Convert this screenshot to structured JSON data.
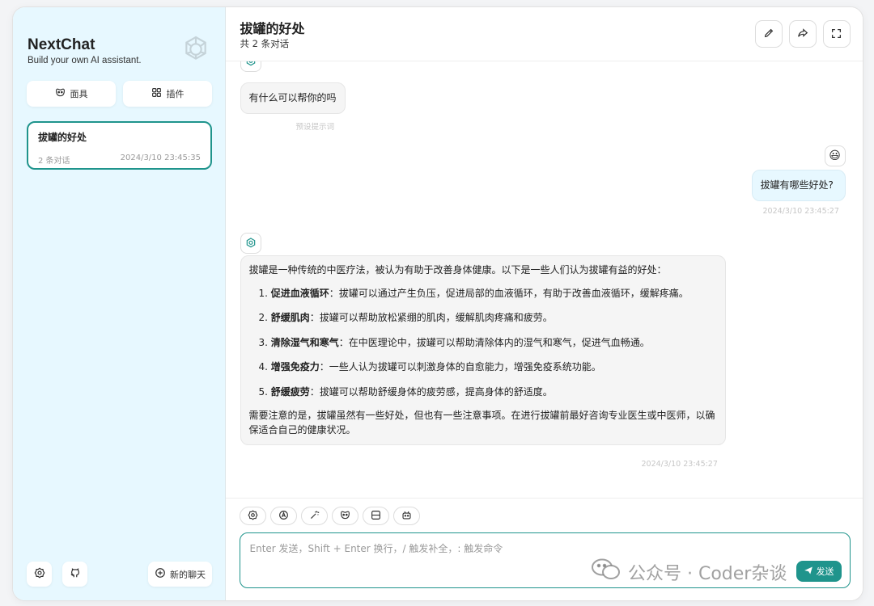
{
  "sidebar": {
    "brand_title": "NextChat",
    "brand_subtitle": "Build your own AI assistant.",
    "mask_label": "面具",
    "plugin_label": "插件",
    "chat_item": {
      "title": "拔罐的好处",
      "count": "2 条对话",
      "time": "2024/3/10 23:45:35"
    },
    "new_chat_label": "新的聊天"
  },
  "header": {
    "title": "拔罐的好处",
    "subtitle": "共 2 条对话"
  },
  "messages": {
    "greeting": "有什么可以帮你的吗",
    "greeting_note": "预设提示词",
    "user_question": "拔罐有哪些好处?",
    "user_time": "2024/3/10 23:45:27",
    "reply_intro": "拔罐是一种传统的中医疗法，被认为有助于改善身体健康。以下是一些人们认为拔罐有益的好处：",
    "reply_items": [
      {
        "num": "1.",
        "title": "促进血液循环",
        "text": "：拔罐可以通过产生负压，促进局部的血液循环，有助于改善血液循环，缓解疼痛。"
      },
      {
        "num": "2.",
        "title": "舒缓肌肉",
        "text": "：拔罐可以帮助放松紧绷的肌肉，缓解肌肉疼痛和疲劳。"
      },
      {
        "num": "3.",
        "title": "清除湿气和寒气",
        "text": "：在中医理论中，拔罐可以帮助清除体内的湿气和寒气，促进气血畅通。"
      },
      {
        "num": "4.",
        "title": "增强免疫力",
        "text": "：一些人认为拔罐可以刺激身体的自愈能力，增强免疫系统功能。"
      },
      {
        "num": "5.",
        "title": "舒缓疲劳",
        "text": "：拔罐可以帮助舒缓身体的疲劳感，提高身体的舒适度。"
      }
    ],
    "reply_outro": "需要注意的是，拔罐虽然有一些好处，但也有一些注意事项。在进行拔罐前最好咨询专业医生或中医师，以确保适合自己的健康状况。",
    "reply_time": "2024/3/10 23:45:27",
    "user_avatar": "😃"
  },
  "composer": {
    "placeholder": "Enter 发送，Shift + Enter 换行，/ 触发补全，: 触发命令",
    "send_label": "发送"
  },
  "watermark": "公众号 · Coder杂谈",
  "colors": {
    "accent": "#1f948c",
    "sidebar_bg": "#e7f8ff",
    "user_bubble": "#e7f8ff",
    "bot_bubble": "#f5f5f5"
  }
}
